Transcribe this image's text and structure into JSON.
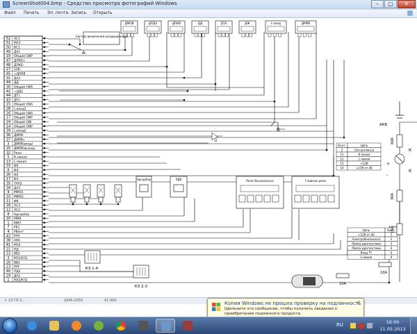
{
  "window": {
    "title": "ScreenShot004.bmp - Средство просмотра фотографий Windows"
  },
  "menu": {
    "items": [
      "Файл",
      "Печать",
      "Эл. почта",
      "Запись",
      "Открыть"
    ]
  },
  "diagram": {
    "pins": [
      {
        "no": "52",
        "name": "ЭС1"
      },
      {
        "no": "51",
        "name": "МЗЗ"
      },
      {
        "no": "50",
        "name": "ВС1"
      },
      {
        "no": "49",
        "name": "ДА1"
      },
      {
        "no": "19",
        "name": "Общий GNP"
      },
      {
        "no": "47",
        "name": "ДЛКБ+"
      },
      {
        "no": "48",
        "name": "ДЛКБ-"
      },
      {
        "no": "27",
        "name": "12В"
      },
      {
        "no": "45",
        "name": "+ДПКВ"
      },
      {
        "no": "31",
        "name": "ДА2"
      },
      {
        "no": "44",
        "name": "ДД"
      },
      {
        "no": "30",
        "name": "Общий GNA"
      },
      {
        "no": "42",
        "name": "+ДД1"
      },
      {
        "no": "44",
        "name": "ДТ1"
      },
      {
        "no": "43",
        "name": "ДТ2"
      },
      {
        "no": "15",
        "name": "Общий GNA"
      },
      {
        "no": "28",
        "name": "L-вход1"
      },
      {
        "no": "16",
        "name": "Общий GNA"
      },
      {
        "no": "17",
        "name": "Общий GNP"
      },
      {
        "no": "24",
        "name": "Общий GNI"
      },
      {
        "no": "14",
        "name": "Общий GNP"
      },
      {
        "no": "39",
        "name": "L-вход2"
      },
      {
        "no": "36",
        "name": "ДМРВ-"
      },
      {
        "no": "37",
        "name": "ДМРВ+"
      },
      {
        "no": "3",
        "name": "ДМРВ(вход)"
      },
      {
        "no": "25",
        "name": "ДМРВ(выход)"
      },
      {
        "no": "32",
        "name": "Ркан"
      },
      {
        "no": "5",
        "name": "К-линия"
      },
      {
        "no": "13",
        "name": "L-линия"
      },
      {
        "no": "33",
        "name": "Ф4"
      },
      {
        "no": "6",
        "name": "Ф3"
      },
      {
        "no": "26",
        "name": "Ф2"
      },
      {
        "no": "17",
        "name": "Ф1"
      },
      {
        "no": "35",
        "name": "ТАХ2"
      },
      {
        "no": "34",
        "name": "ДАЗ"
      },
      {
        "no": "9",
        "name": "ММО1"
      },
      {
        "no": "10",
        "name": "ММО2"
      },
      {
        "no": "11",
        "name": "Ф8"
      },
      {
        "no": "18",
        "name": "ЭС3"
      },
      {
        "no": "12",
        "name": "ЭС2"
      },
      {
        "no": "8",
        "name": "Адсорбер"
      },
      {
        "no": "16",
        "name": "ММ6"
      },
      {
        "no": "1",
        "name": "ММ7"
      },
      {
        "no": "7",
        "name": "РБ1"
      },
      {
        "no": "4",
        "name": "РВент"
      },
      {
        "no": "42",
        "name": "РТП"
      },
      {
        "no": "38",
        "name": "АКБ"
      },
      {
        "no": "41",
        "name": "МЗ4"
      },
      {
        "no": "21",
        "name": "ПД"
      },
      {
        "no": "22",
        "name": "ВВ2"
      },
      {
        "no": "2",
        "name": "МЗ1/КЗ1"
      },
      {
        "no": "20",
        "name": "ВВ1"
      },
      {
        "no": "23",
        "name": "ПРГ"
      },
      {
        "no": "40",
        "name": "ПД2"
      },
      {
        "no": "29",
        "name": "ДА2"
      },
      {
        "no": "1",
        "name": "МЗ2/КЗ2"
      }
    ],
    "switch_label": "Сигнал включения кондиционера",
    "node_a": "А",
    "node_b": "Б",
    "sensors": [
      "ДМОВ",
      "ДПДЗ",
      "ДПКВ",
      "ДД",
      "ДТА",
      "ДЖ",
      "L-зонд",
      "ДМРВ"
    ],
    "connector_x2": {
      "header": [
        "Конт.",
        "Цепь"
      ],
      "rows": [
        [
          "2",
          "Сигнал масса"
        ],
        [
          "11",
          "К-линия"
        ],
        [
          "12",
          "L-линия"
        ],
        [
          "13",
          "+12В"
        ],
        [
          "14",
          "+12В от АБ"
        ]
      ]
    },
    "adsorber": "Адсорбер",
    "rdv": "РДВ",
    "relay_block_left": "Реле бензонасоса",
    "relay_block_right": "Главное реле",
    "diag_table": {
      "header": [
        "Цепь",
        "Конт."
      ],
      "rows": [
        [
          "+12В от АБ",
          "1"
        ],
        [
          "Электробензонасос",
          "2"
        ],
        [
          "Лампа диагностики",
          "3"
        ],
        [
          "Лампа диагностики",
          "4"
        ],
        [
          "Вход ТТ",
          "5"
        ],
        [
          "L-линия",
          "6"
        ]
      ]
    },
    "kz14": "КЗ 1-4",
    "kz23": "КЗ 2-3",
    "akb": "АКБ",
    "fuse_60a": "60А",
    "fuse_30a": "30А",
    "fuse_15a": "15А",
    "fuse_10a_a": "10А",
    "fuse_10a_b": "10А",
    "letter_k": "К",
    "mark_plus": "+",
    "mark_minus": "-"
  },
  "status_strip": {
    "left": "+ 13 ГЛ 2...",
    "mid1": "2045-2055",
    "mid2": "41.000"
  },
  "notification": {
    "title": "Копия Windows не прошла проверку на подлинность",
    "body": "Щелкните это сообщение, чтобы получить сведения о приобретении подлинного продукта."
  },
  "tray": {
    "lang": "RU",
    "time": "16:00",
    "date": "11.05.2013"
  },
  "colors": {
    "taskbar": "#2b4878",
    "titlebar": "#c4d8ee",
    "notif_bg": "#fffbe0"
  }
}
